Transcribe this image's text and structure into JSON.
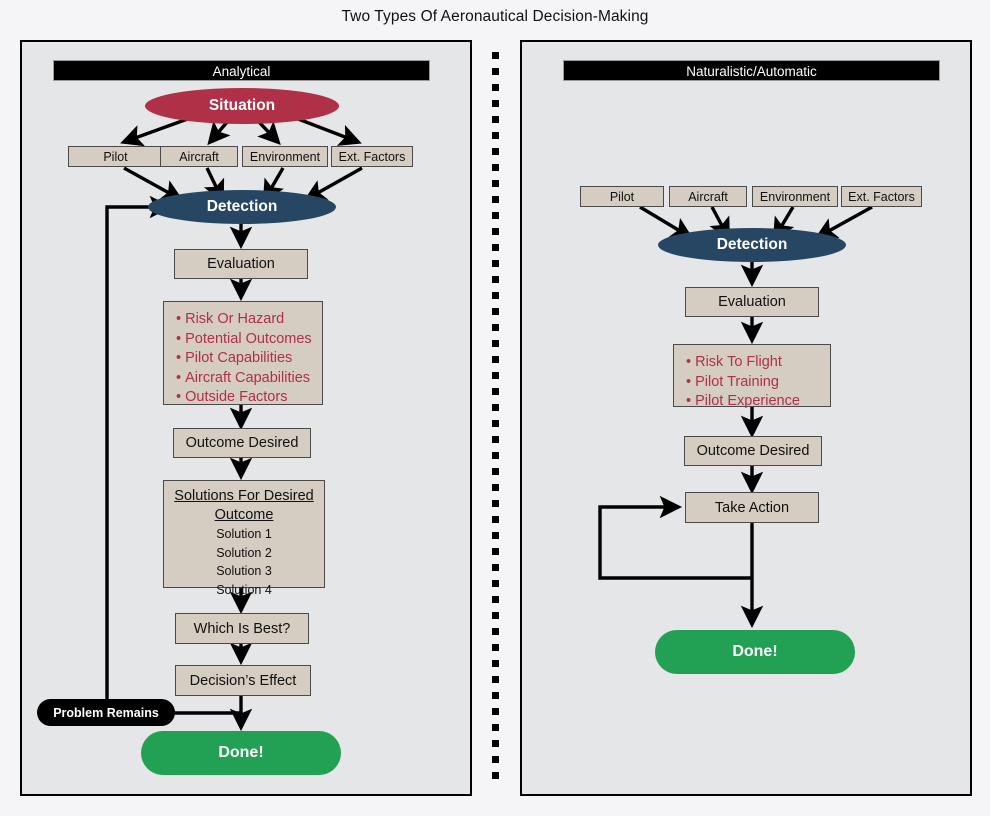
{
  "title": "Two Types Of Aeronautical Decision-Making",
  "colors": {
    "crimson": "#b03048",
    "navy": "#264664",
    "green": "#22a054",
    "tan": "#d5ccc2",
    "panel_bg": "#e4e6e8",
    "header_bg": "#000000",
    "page_bg": "#f5f5f7"
  },
  "panels": [
    {
      "id": "analytical",
      "header": "Analytical",
      "nodes": {
        "situation": "Situation",
        "factors": [
          "Pilot",
          "Aircraft",
          "Environment",
          "Ext. Factors"
        ],
        "detection": "Detection",
        "evaluation": "Evaluation",
        "risk_items": [
          "Risk Or Hazard",
          "Potential Outcomes",
          "Pilot Capabilities",
          "Aircraft Capabilities",
          "Outside Factors"
        ],
        "outcome_desired": "Outcome Desired",
        "solutions_title": "Solutions For Desired Outcome",
        "solutions": [
          "Solution 1",
          "Solution 2",
          "Solution 3",
          "Solution 4"
        ],
        "which_is_best": "Which Is Best?",
        "decisions_effect": "Decision’s Effect",
        "problem_remains": "Problem Remains",
        "done": "Done!"
      }
    },
    {
      "id": "naturalistic",
      "header": "Naturalistic/Automatic",
      "nodes": {
        "factors": [
          "Pilot",
          "Aircraft",
          "Environment",
          "Ext. Factors"
        ],
        "detection": "Detection",
        "evaluation": "Evaluation",
        "risk_items": [
          "Risk To Flight",
          "Pilot Training",
          "Pilot Experience"
        ],
        "outcome_desired": "Outcome Desired",
        "take_action": "Take Action",
        "done": "Done!"
      }
    }
  ]
}
